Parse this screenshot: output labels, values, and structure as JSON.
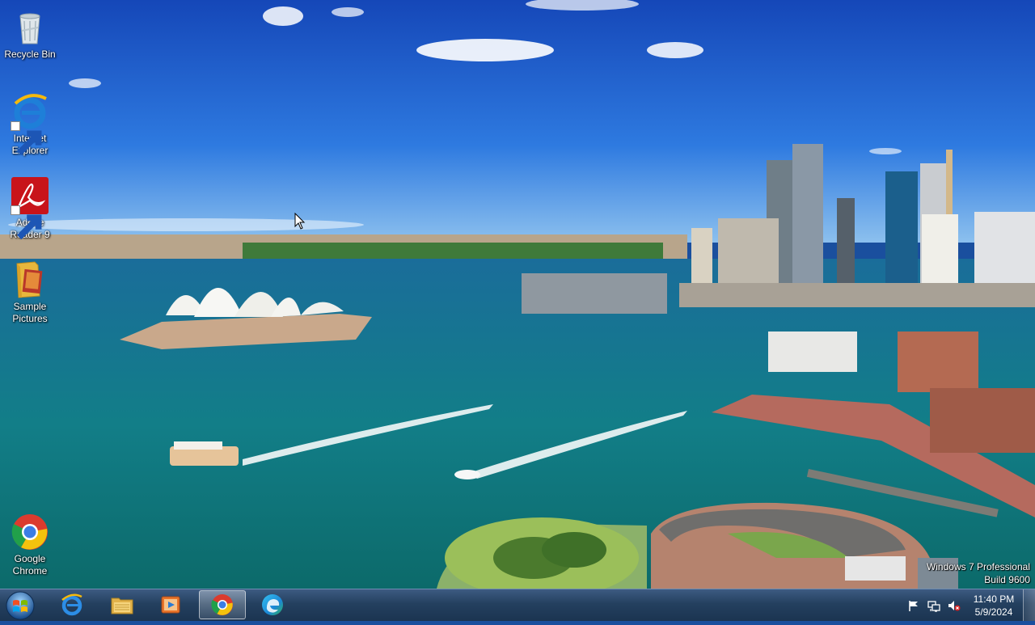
{
  "desktop": {
    "icons": [
      {
        "label": "Recycle Bin",
        "icon": "recycle-bin-icon"
      },
      {
        "label": "Internet Explorer",
        "icon": "internet-explorer-icon"
      },
      {
        "label": "Adobe Reader 9",
        "icon": "adobe-reader-icon"
      },
      {
        "label": "Sample Pictures",
        "icon": "folder-icon"
      },
      {
        "label": "Google Chrome",
        "icon": "chrome-icon"
      }
    ]
  },
  "watermark": {
    "line1": "Windows 7 Professional",
    "line2": "Build 9600"
  },
  "taskbar": {
    "pinned": [
      {
        "icon": "internet-explorer-icon",
        "active": false
      },
      {
        "icon": "file-explorer-icon",
        "active": false
      },
      {
        "icon": "media-player-icon",
        "active": false
      },
      {
        "icon": "chrome-icon",
        "active": true
      },
      {
        "icon": "edge-icon",
        "active": false
      }
    ],
    "tray": [
      "action-center-flag-icon",
      "network-icon",
      "volume-muted-icon"
    ],
    "clock": {
      "time": "11:40 PM",
      "date": "5/9/2024"
    }
  },
  "colors": {
    "sky": "#1f5fcf",
    "water": "#147a8a",
    "taskbar": "#24405f"
  }
}
